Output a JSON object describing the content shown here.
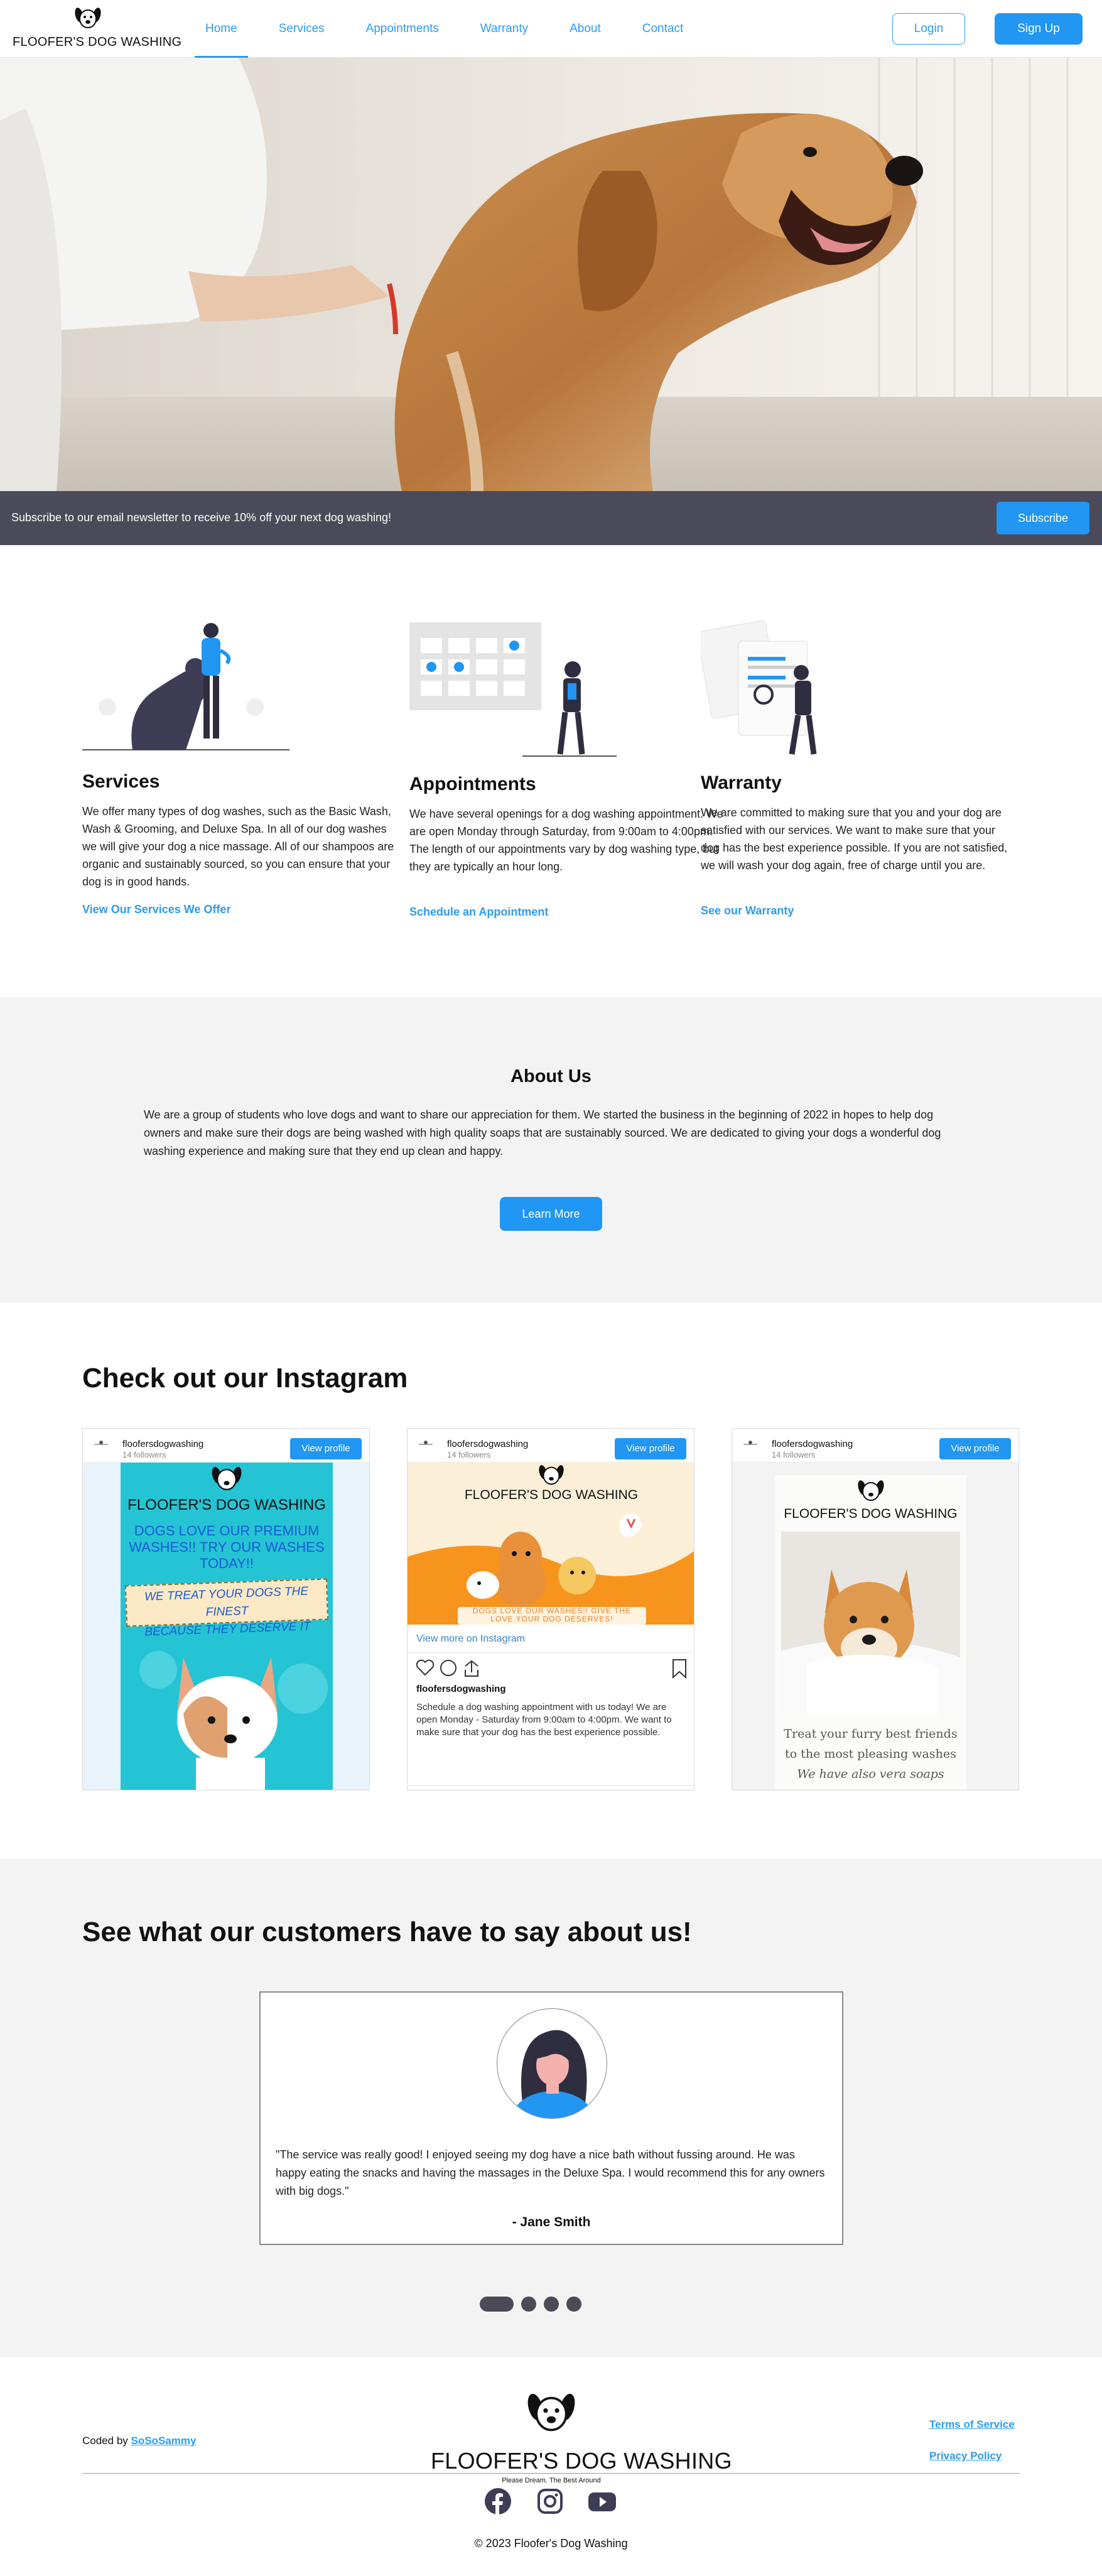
{
  "brand": {
    "name": "FLOOFER'S DOG WASHING",
    "tagline": "Please Dream. The Best Around"
  },
  "nav": {
    "links": [
      "Home",
      "Services",
      "Appointments",
      "Warranty",
      "About",
      "Contact"
    ],
    "active": "Home",
    "login": "Login",
    "signup": "Sign Up"
  },
  "newsletter": {
    "text": "Subscribe to our email newsletter to receive 10% off your next dog washing!",
    "button": "Subscribe"
  },
  "features": [
    {
      "title": "Services",
      "text": "We offer many types of dog washes, such as the Basic Wash, Wash & Grooming, and Deluxe Spa. In all of our dog washes we will give your dog a nice massage. All of our shampoos are organic and sustainably sourced, so you can ensure that your dog is in good hands.",
      "link": "View Our Services We Offer"
    },
    {
      "title": "Appointments",
      "text": "We have several openings for a dog washing appointment. We are open Monday through Saturday, from 9:00am to 4:00pm. The length of our appointments vary by dog washing type, but they are typically an hour long.",
      "link": "Schedule an Appointment"
    },
    {
      "title": "Warranty",
      "text": "We are committed to making sure that you and your dog are satisfied with our services. We want to make sure that your dog has the best experience possible. If you are not satisfied, we will wash your dog again, free of charge until you are.",
      "link": "See our Warranty"
    }
  ],
  "about": {
    "title": "About Us",
    "text": "We are a group of students who love dogs and want to share our appreciation for them. We started the business in the beginning of 2022 in hopes to help dog owners and make sure their dogs are being washed with high quality soaps that are sustainably sourced. We are dedicated to giving your dogs a wonderful dog washing experience and making sure that they end up clean and happy.",
    "button": "Learn More"
  },
  "instagram": {
    "title": "Check out our Instagram",
    "username": "floofersdogwashing",
    "followers": "14 followers",
    "view_profile": "View profile",
    "view_more": "View more on Instagram",
    "caption": "Schedule a dog washing appointment with us today! We are open Monday - Saturday from 9:00am to 4:00pm. We want to make sure that your dog has the best experience possible.",
    "post1": {
      "line1": "DOGS LOVE OUR PREMIUM",
      "line2": "WASHES!! TRY OUR WASHES",
      "line3": "TODAY!!",
      "banner1": "WE TREAT YOUR DOGS THE FINEST",
      "banner2": "BECAUSE THEY DESERVE IT"
    },
    "post2": {
      "ribbon1": "DOGS LOVE OUR WASHES!! GIVE THE",
      "ribbon2": "LOVE YOUR DOG DESERVES!"
    },
    "post3": {
      "line1": "Treat your furry best friends",
      "line2": "to the most pleasing washes",
      "line3": "We have also vera soaps"
    }
  },
  "testimonials": {
    "title": "See what our customers have to say about us!",
    "quote": "\"The service was really good! I enjoyed seeing my dog have a nice bath without fussing around. He was happy eating the snacks and having the massages in the Deluxe Spa. I would recommend this for any owners with big dogs.\"",
    "author": "- Jane Smith",
    "slide_count": 4,
    "active_slide": 1
  },
  "footer": {
    "coded_by_prefix": "Coded by ",
    "coded_by_link": "SoSoSammy",
    "terms": "Terms of Service",
    "privacy": "Privacy Policy",
    "social_icons": [
      "facebook-icon",
      "instagram-icon",
      "youtube-icon"
    ],
    "copyright": "© 2023 Floofer's Dog Washing"
  },
  "colors": {
    "accent": "#2196f3",
    "dark": "#4b4a58",
    "light_bg": "#f3f3f3"
  }
}
